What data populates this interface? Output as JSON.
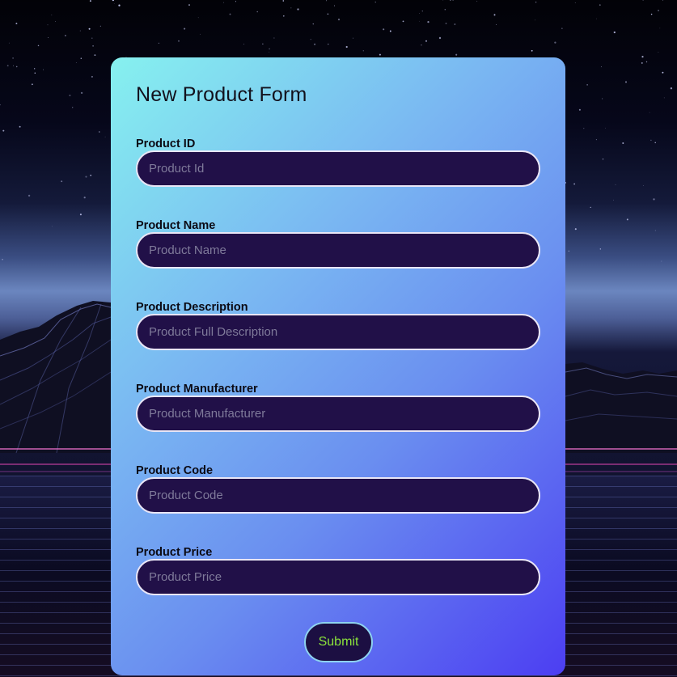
{
  "form": {
    "title": "New Product Form",
    "fields": [
      {
        "label": "Product ID",
        "placeholder": "Product Id",
        "value": ""
      },
      {
        "label": "Product Name",
        "placeholder": "Product Name",
        "value": ""
      },
      {
        "label": "Product Description",
        "placeholder": "Product Full Description",
        "value": ""
      },
      {
        "label": "Product Manufacturer",
        "placeholder": "Product Manufacturer",
        "value": ""
      },
      {
        "label": "Product Code",
        "placeholder": "Product Code",
        "value": ""
      },
      {
        "label": "Product Price",
        "placeholder": "Product Price",
        "value": ""
      }
    ],
    "submit_label": "Submit"
  },
  "colors": {
    "card_gradient_start": "#86f1ef",
    "card_gradient_end": "#4c3ef2",
    "input_background": "#211048",
    "input_border": "#e9e6f6",
    "submit_text": "#8be33b",
    "submit_border": "#8ed3f0"
  }
}
